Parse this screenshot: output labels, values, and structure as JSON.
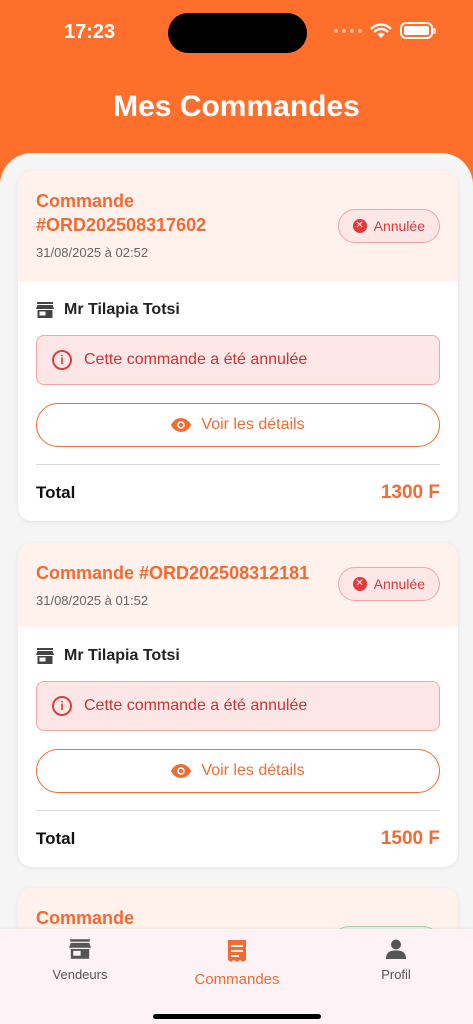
{
  "status_bar": {
    "time": "17:23"
  },
  "page": {
    "title": "Mes Commandes"
  },
  "orders": [
    {
      "id_line1": "Commande",
      "id_line2": "#ORD202508317602",
      "date": "31/08/2025 à 02:52",
      "status": "Annulée",
      "vendor": "Mr Tilapia Totsi",
      "alert": "Cette commande a été annulée",
      "details_label": "Voir les détails",
      "total_label": "Total",
      "total_value": "1300 F"
    },
    {
      "id_line1": "Commande #ORD202508312181",
      "date": "31/08/2025 à 01:52",
      "status": "Annulée",
      "vendor": "Mr Tilapia Totsi",
      "alert": "Cette commande a été annulée",
      "details_label": "Voir les détails",
      "total_label": "Total",
      "total_value": "1500 F"
    },
    {
      "id_line1": "Commande"
    }
  ],
  "tabbar": {
    "items": [
      {
        "label": "Vendeurs",
        "icon": "store-icon"
      },
      {
        "label": "Commandes",
        "icon": "receipt-icon",
        "active": true
      },
      {
        "label": "Profil",
        "icon": "person-icon"
      }
    ]
  },
  "colors": {
    "accent": "#ff6f2c",
    "danger": "#d63c3c"
  }
}
